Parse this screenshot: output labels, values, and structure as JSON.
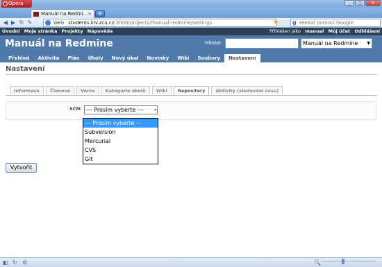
{
  "browser": {
    "menu_label": "Opera",
    "tab_title": "Manuál na Redmi...",
    "web_label": "Web",
    "url_host": "students.kiv.zcu.cz",
    "url_rest": ":3000/projects/manual-redmine/settings",
    "search_placeholder": "Hledat pomocí Google",
    "window_buttons": [
      "_",
      "□",
      "✕"
    ]
  },
  "topmenu": {
    "left": [
      "Úvodní",
      "Moje stránka",
      "Projekty",
      "Nápověda"
    ],
    "logged_as_label": "Přihlášen jako",
    "username": "manual",
    "my_account": "Můj účet",
    "logout": "Odhlášení"
  },
  "header": {
    "title": "Manuál na Redmine",
    "search_label": "Hledat:",
    "project_select": "Manuál na Redmine"
  },
  "mainmenu": [
    "Přehled",
    "Aktivita",
    "Plán",
    "Úkoly",
    "Nový úkol",
    "Novinky",
    "Wiki",
    "Soubory",
    "Nastavení"
  ],
  "mainmenu_selected": "Nastavení",
  "page": {
    "heading": "Nastavení",
    "tabs": [
      "Informace",
      "Členové",
      "Verze",
      "Kategorie úkolů",
      "Wiki",
      "Repository",
      "Aktivity (sledování času)"
    ],
    "selected_tab": "Repository",
    "scm_label": "SCM",
    "scm_value": "--- Prosím vyberte ---",
    "create_button": "Vytvořit"
  },
  "dropdown": {
    "options": [
      "--- Prosím vyberte ---",
      "Subversion",
      "Mercurial",
      "CVS",
      "Git"
    ],
    "highlighted": 0
  }
}
